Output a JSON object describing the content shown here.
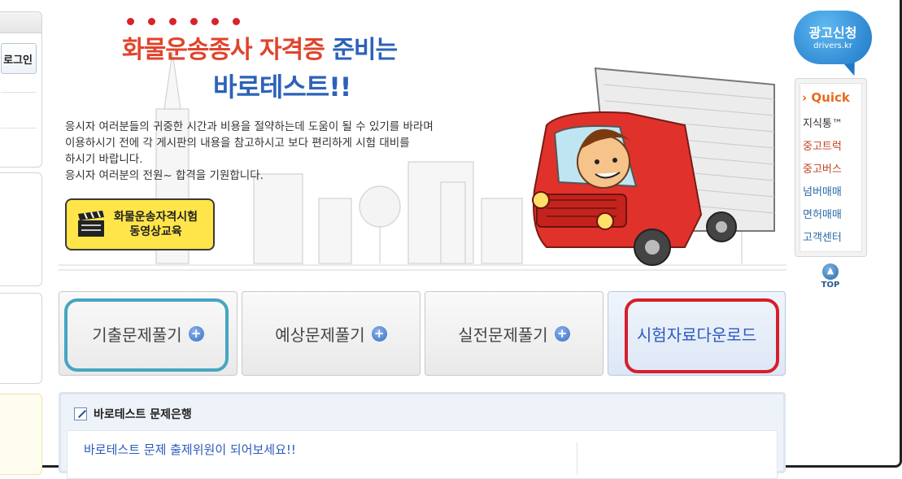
{
  "sidebar": {
    "login_label": "로그인"
  },
  "hero": {
    "title_red": "화물운송종사 자격증",
    "title_blue": "준비는",
    "title_line2": "바로테스트!!",
    "desc_lines": [
      "응시자 여러분들의 귀중한 시간과 비용을 절약하는데 도움이 될 수 있기를 바라며",
      "이용하시기  전에 각 게시판의 내용을 참고하시고 보다 편리하게 시험 대비를",
      "하시기 바랍니다.",
      "응시자 여러분의 전원~ 합격을 기원합니다."
    ],
    "video_button": {
      "line1": "화물운송자격시험",
      "line2": "동영상교육"
    }
  },
  "ad": {
    "title": "광고신청",
    "site": "drivers.kr"
  },
  "quick": {
    "title": "› Quick",
    "items": [
      {
        "label": "지식통™",
        "color": "#333333"
      },
      {
        "label": "중고트럭",
        "color": "#c0461e"
      },
      {
        "label": "중고버스",
        "color": "#c0461e"
      },
      {
        "label": "넘버매매",
        "color": "#2a6aa8"
      },
      {
        "label": "면허매매",
        "color": "#2a6aa8"
      },
      {
        "label": "고객센터",
        "color": "#2a6aa8"
      }
    ],
    "top_label": "TOP"
  },
  "menu": {
    "past": "기출문제풀기",
    "expected": "예상문제풀기",
    "practice": "실전문제풀기",
    "download": "시험자료다운로드"
  },
  "bank": {
    "title": "바로테스트 문제은행",
    "link": "바로테스트 문제 출제위원이 되어보세요!!"
  },
  "colors": {
    "accent_blue": "#2d62b8",
    "accent_red": "#e0442d",
    "highlight_teal": "#46a5c2",
    "highlight_red": "#d61f2c"
  }
}
